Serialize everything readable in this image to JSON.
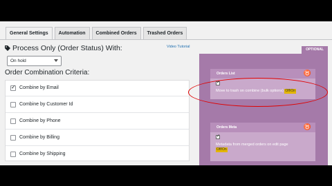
{
  "tabs": [
    "General Settings",
    "Automation",
    "Combined Orders",
    "Trashed Orders"
  ],
  "process_title": "Process Only (Order Status) With:",
  "status_select": "On hold",
  "video_link": "Video Tutorial",
  "combination_title": "Order Combination Criteria:",
  "criteria": [
    {
      "label": "Combine by Email",
      "checked": true
    },
    {
      "label": "Combine by Customer Id",
      "checked": false
    },
    {
      "label": "Combine by Phone",
      "checked": false
    },
    {
      "label": "Combine by Billing",
      "checked": false
    },
    {
      "label": "Combine by Shipping",
      "checked": false
    }
  ],
  "optional_label": "OPTIONAL",
  "cards": [
    {
      "title": "Orders List",
      "desc": "Move to trash on combine (bulk options)",
      "toggle": "Off/On",
      "checked": true
    },
    {
      "title": "Orders Meta",
      "desc": "Metadata from merged orders on edit page",
      "toggle": "Off/On",
      "checked": true
    }
  ],
  "colors": {
    "panel": "#a57aa9",
    "highlight": "#e00000",
    "link": "#2271b1"
  }
}
